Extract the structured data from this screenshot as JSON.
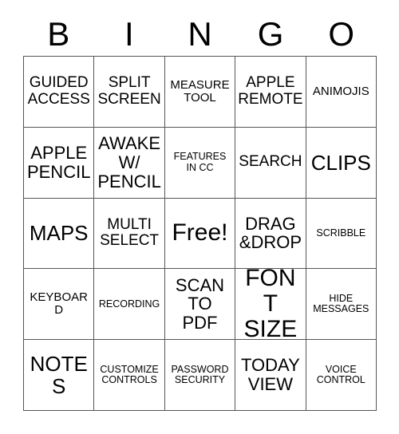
{
  "card": {
    "type": "bingo-card",
    "title_letters": [
      "B",
      "I",
      "N",
      "G",
      "O"
    ],
    "columns": 5,
    "rows": 5,
    "background_color": "#ffffff",
    "text_color": "#000000",
    "border_color": "#555555",
    "free_space": "Free!",
    "free_space_position": "center"
  },
  "header": {
    "b": "B",
    "i": "I",
    "n": "N",
    "g": "G",
    "o": "O"
  },
  "grid": {
    "rows": [
      {
        "cells": [
          {
            "text": "GUIDED\nACCESS",
            "size": "md"
          },
          {
            "text": "SPLIT\nSCREEN",
            "size": "md"
          },
          {
            "text": "MEASURE\nTOOL",
            "size": "sm"
          },
          {
            "text": "APPLE\nREMOTE",
            "size": "md"
          },
          {
            "text": "ANIMOJIS",
            "size": "sm"
          }
        ]
      },
      {
        "cells": [
          {
            "text": "APPLE\nPENCIL",
            "size": "lg"
          },
          {
            "text": "AWAKE\nW/\nPENCIL",
            "size": "lg"
          },
          {
            "text": "FEATURES\nIN CC",
            "size": "xs"
          },
          {
            "text": "SEARCH",
            "size": "md"
          },
          {
            "text": "CLIPS",
            "size": "xl"
          }
        ]
      },
      {
        "cells": [
          {
            "text": "MAPS",
            "size": "xl"
          },
          {
            "text": "MULTI\nSELECT",
            "size": "md"
          },
          {
            "text": "Free!",
            "size": "xxl"
          },
          {
            "text": "DRAG\n&DROP",
            "size": "lg"
          },
          {
            "text": "SCRIBBLE",
            "size": "xs"
          }
        ]
      },
      {
        "cells": [
          {
            "text": "KEYBOARD",
            "size": "sm"
          },
          {
            "text": "RECORDING",
            "size": "xs"
          },
          {
            "text": "SCAN\nTO\nPDF",
            "size": "lg"
          },
          {
            "text": "FONT\nSIZE",
            "size": "xxl"
          },
          {
            "text": "HIDE\nMESSAGES",
            "size": "xs"
          }
        ]
      },
      {
        "cells": [
          {
            "text": "NOTES",
            "size": "xl"
          },
          {
            "text": "CUSTOMIZE\nCONTROLS",
            "size": "xs"
          },
          {
            "text": "PASSWORD\nSECURITY",
            "size": "xs"
          },
          {
            "text": "TODAY\nVIEW",
            "size": "lg"
          },
          {
            "text": "VOICE\nCONTROL",
            "size": "xs"
          }
        ]
      }
    ]
  }
}
